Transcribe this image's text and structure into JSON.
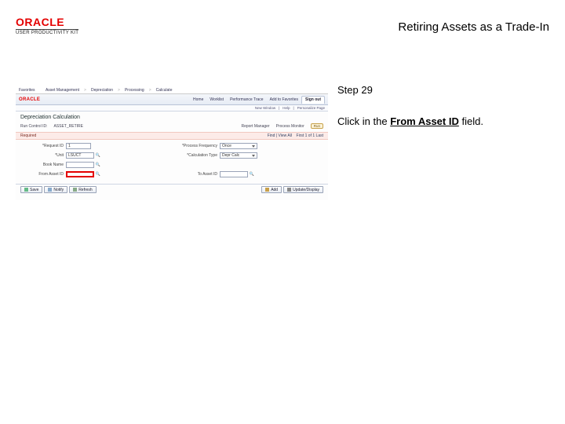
{
  "header": {
    "logo_text": "ORACLE",
    "logo_sub": "USER PRODUCTIVITY KIT",
    "title": "Retiring Assets as a Trade-In"
  },
  "instruction": {
    "step_label": "Step 29",
    "text_before": "Click in the ",
    "text_bold": "From Asset ID",
    "text_after": " field."
  },
  "shot": {
    "nav": {
      "items": [
        "Favorites",
        "Asset Management",
        "Depreciation",
        "Processing",
        "Calculate"
      ]
    },
    "mini_logo": "ORACLE",
    "tabs": [
      "Home",
      "Worklist",
      "Performance Trace",
      "Add to Favorites",
      "Sign out"
    ],
    "strip": {
      "left": "New Window",
      "mid": "Help",
      "right": "Personalize Page"
    },
    "page_title": "Depreciation Calculation",
    "info": {
      "runctrl_lbl": "Run Control ID:",
      "runctrl_val": "ASSET_RETIRE",
      "report_lbl": "Report Manager",
      "process_lbl": "Process Monitor",
      "run_btn": "Run"
    },
    "warn": {
      "left_label": "Required",
      "right_find": "Find | View All",
      "right_count": "First  1 of 1  Last"
    },
    "form": {
      "req_lbl": "*Request ID",
      "req_val": "1",
      "pf_lbl": "*Process Frequency",
      "pf_val": "Once",
      "unit_lbl": "*Unit",
      "unit_val": "LSUCT",
      "depr_lbl": "*Calculation Type",
      "depr_val": "Depr Calc",
      "book_lbl": "Book Name",
      "book_val": "",
      "from_lbl": "From Asset ID",
      "from_val": "",
      "to_lbl": "To Asset ID",
      "to_val": ""
    },
    "buttons": {
      "save": "Save",
      "notify": "Notify",
      "refresh": "Refresh",
      "add": "Add",
      "update": "Update/Display"
    }
  }
}
